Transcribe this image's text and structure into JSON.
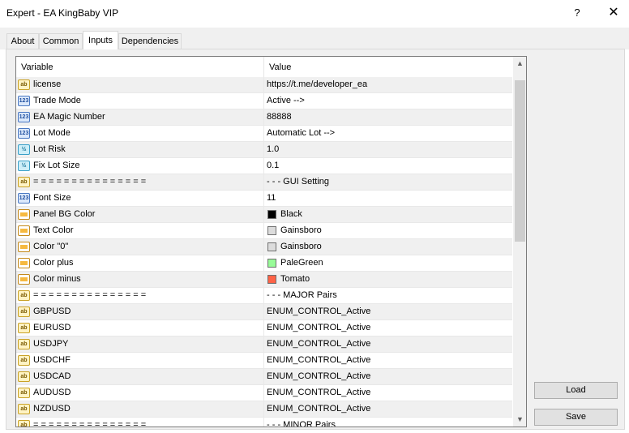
{
  "window": {
    "title": "Expert - EA KingBaby VIP",
    "help": "?",
    "close": "✕"
  },
  "tabs": [
    {
      "label": "About"
    },
    {
      "label": "Common"
    },
    {
      "label": "Inputs"
    },
    {
      "label": "Dependencies"
    }
  ],
  "active_tab": "Inputs",
  "table": {
    "headers": {
      "variable": "Variable",
      "value": "Value"
    },
    "rows": [
      {
        "icon": "ab-icon",
        "name": "license",
        "value": "https://t.me/developer_ea"
      },
      {
        "icon": "int-icon",
        "name": "Trade Mode",
        "value": "Active -->"
      },
      {
        "icon": "int-icon",
        "name": "EA Magic Number",
        "value": "88888"
      },
      {
        "icon": "int-icon",
        "name": "Lot Mode",
        "value": "Automatic Lot -->"
      },
      {
        "icon": "double-icon",
        "name": "Lot Risk",
        "value": "1.0"
      },
      {
        "icon": "double-icon",
        "name": "Fix Lot Size",
        "value": "0.1"
      },
      {
        "icon": "ab-icon",
        "name": "= = = = = = = = = = = = = = =",
        "value": "- - - GUI Setting"
      },
      {
        "icon": "int-icon",
        "name": "Font Size",
        "value": "11"
      },
      {
        "icon": "color-icon",
        "name": "Panel BG Color",
        "value": "Black",
        "swatch": "#000000"
      },
      {
        "icon": "color-icon",
        "name": "Text Color",
        "value": "Gainsboro",
        "swatch": "#dcdcdc"
      },
      {
        "icon": "color-icon",
        "name": "Color \"0\"",
        "value": "Gainsboro",
        "swatch": "#dcdcdc"
      },
      {
        "icon": "color-icon",
        "name": "Color plus",
        "value": "PaleGreen",
        "swatch": "#98fb98"
      },
      {
        "icon": "color-icon",
        "name": "Color minus",
        "value": "Tomato",
        "swatch": "#ff6347"
      },
      {
        "icon": "ab-icon",
        "name": "= = = = = = = = = = = = = = =",
        "value": "- - - MAJOR Pairs"
      },
      {
        "icon": "ab-icon",
        "name": "GBPUSD",
        "value": "ENUM_CONTROL_Active"
      },
      {
        "icon": "ab-icon",
        "name": "EURUSD",
        "value": "ENUM_CONTROL_Active"
      },
      {
        "icon": "ab-icon",
        "name": "USDJPY",
        "value": "ENUM_CONTROL_Active"
      },
      {
        "icon": "ab-icon",
        "name": "USDCHF",
        "value": "ENUM_CONTROL_Active"
      },
      {
        "icon": "ab-icon",
        "name": "USDCAD",
        "value": "ENUM_CONTROL_Active"
      },
      {
        "icon": "ab-icon",
        "name": "AUDUSD",
        "value": "ENUM_CONTROL_Active"
      },
      {
        "icon": "ab-icon",
        "name": "NZDUSD",
        "value": "ENUM_CONTROL_Active"
      },
      {
        "icon": "ab-icon",
        "name": "= = = = = = = = = = = = = = =",
        "value": "- - - MINOR Pairs"
      }
    ]
  },
  "buttons": {
    "load": "Load",
    "save": "Save"
  }
}
